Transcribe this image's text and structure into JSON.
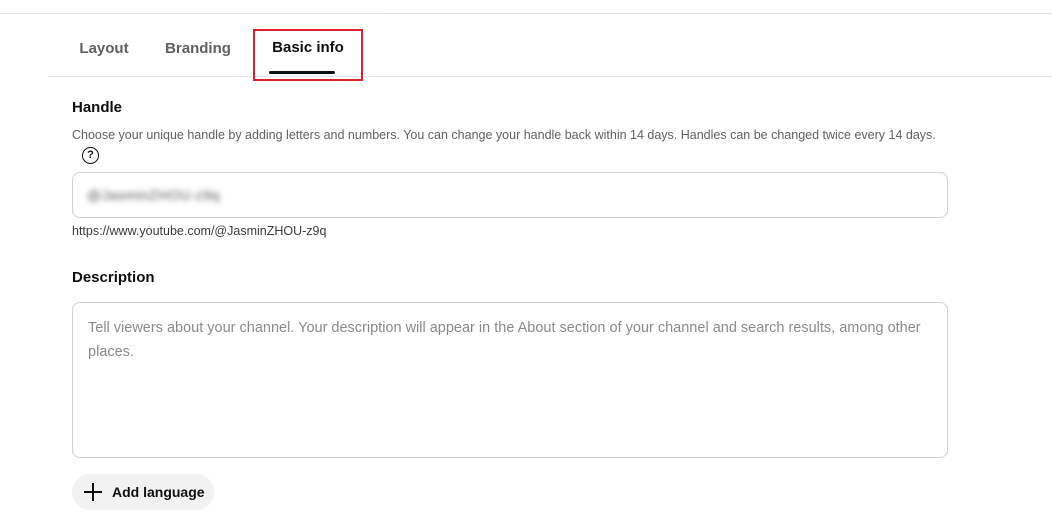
{
  "tabs": [
    {
      "label": "Layout",
      "active": false
    },
    {
      "label": "Branding",
      "active": false
    },
    {
      "label": "Basic info",
      "active": true
    }
  ],
  "handle": {
    "title": "Handle",
    "help": "Choose your unique handle by adding letters and numbers. You can change your handle back within 14 days. Handles can be changed twice every 14 days.",
    "help_icon": "?",
    "value": "@JasminZHOU-z9q",
    "url": "https://www.youtube.com/@JasminZHOU-z9q"
  },
  "description": {
    "title": "Description",
    "placeholder": "Tell viewers about your channel. Your description will appear in the About section of your channel and search results, among other places."
  },
  "add_language": {
    "label": "Add language"
  },
  "colors": {
    "highlight_border": "#e0202a",
    "text_primary": "#0f0f0f",
    "text_secondary": "#606060"
  }
}
